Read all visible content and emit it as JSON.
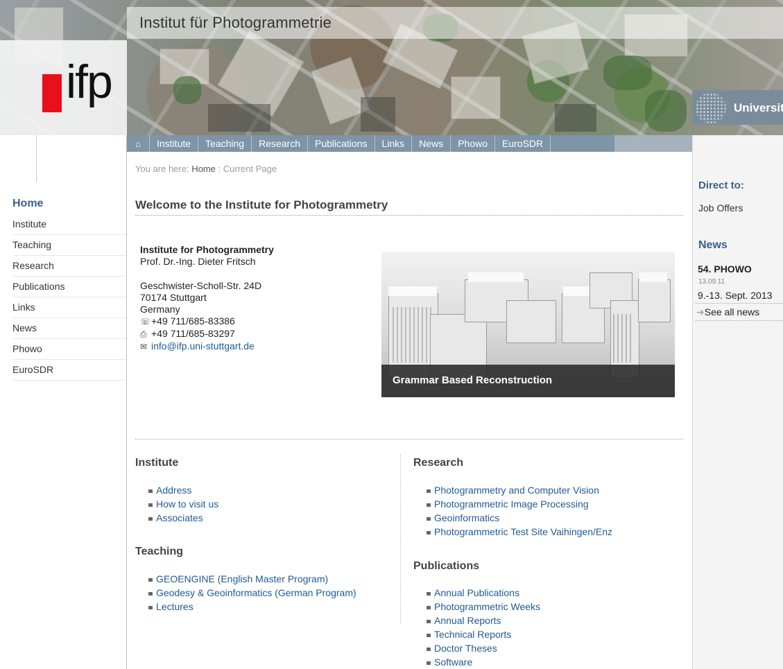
{
  "header": {
    "site_title": "Institut für Photogrammetrie",
    "logo_text": "ifp",
    "university_text": "Universit"
  },
  "topnav": {
    "home_icon": "home-icon",
    "items": [
      "Institute",
      "Teaching",
      "Research",
      "Publications",
      "Links",
      "News",
      "Phowo",
      "EuroSDR"
    ]
  },
  "breadcrumb": {
    "prefix": "You are here:",
    "home": "Home",
    "current": ": Current Page"
  },
  "main": {
    "welcome_title": "Welcome to the Institute for Photogrammetry",
    "address": {
      "org": "Institute for Photogrammetry",
      "person": "Prof. Dr.-Ing. Dieter Fritsch",
      "street": "Geschwister-Scholl-Str. 24D",
      "city": "70174 Stuttgart",
      "country": "Germany",
      "phone": "+49 711/685-83386",
      "fax": "+49 711/685-83297",
      "email": "info@ifp.uni-stuttgart.de"
    },
    "feature_caption": "Grammar Based Reconstruction"
  },
  "sections": {
    "institute": {
      "title": "Institute",
      "links": [
        "Address",
        "How to visit us",
        "Associates"
      ]
    },
    "teaching": {
      "title": "Teaching",
      "links": [
        "GEOENGINE (English Master Program)",
        "Geodesy & Geoinformatics (German Program)",
        "Lectures"
      ]
    },
    "research": {
      "title": "Research",
      "links": [
        "Photogrammetry and Computer Vision",
        "Photogrammetric Image Processing",
        "Geoinformatics",
        "Photogrammetric Test Site Vaihingen/Enz"
      ]
    },
    "publications": {
      "title": "Publications",
      "links": [
        "Annual Publications",
        "Photogrammetric Weeks",
        "Annual Reports",
        "Technical Reports",
        "Doctor Theses",
        "Software"
      ]
    }
  },
  "sidebar": {
    "title": "Home",
    "items": [
      "Institute",
      "Teaching",
      "Research",
      "Publications",
      "Links",
      "News",
      "Phowo",
      "EuroSDR"
    ]
  },
  "right": {
    "direct_title": "Direct to:",
    "job_offers": "Job Offers",
    "news_title": "News",
    "news_item_title": "54. PHOWO",
    "news_item_date": "13.09.11",
    "news_item_text": "9.-13. Sept. 2013",
    "see_all": "See all news"
  },
  "colors": {
    "nav_bg": "#7e94a8",
    "heading_blue": "#3c5f84",
    "link_blue": "#1f5a96",
    "logo_red": "#e8101c"
  }
}
